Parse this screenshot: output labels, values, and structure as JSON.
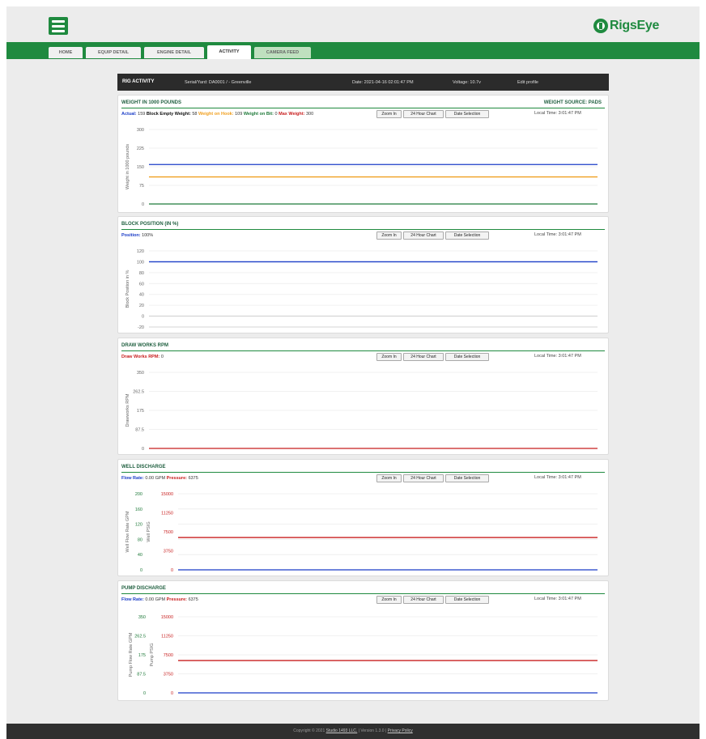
{
  "header": {
    "menu_icon": "hamburger-menu-icon",
    "logo_text": "RigsEye",
    "logo_icon": "rig-derrick-logo-icon",
    "brand_color": "#1f8a3f"
  },
  "nav": {
    "tabs": [
      {
        "label": "HOME"
      },
      {
        "label": "EQUIP DETAIL"
      },
      {
        "label": "ENGINE DETAIL"
      },
      {
        "label": "ACTIVITY"
      },
      {
        "label": "CAMERA FEED"
      }
    ],
    "active": "ACTIVITY"
  },
  "rigbar": {
    "title": "RIG ACTIVITY",
    "serial": "Serial/Yard: DA0001 / - Greenville",
    "date": "Date: 2021-04-16 02:01:47 PM",
    "voltage": "Voltage: 10.7v",
    "edit_profile": "Edit profile"
  },
  "buttons": {
    "zoom": "Zoom In",
    "h24": "24 Hour Chart",
    "date_sel": "Date Selection"
  },
  "panels": {
    "weight": {
      "title": "WEIGHT IN 1000 POUNDS",
      "source": "WEIGHT SOURCE: PADS",
      "info": [
        {
          "label": "Actual:",
          "value": "159",
          "color": "#1a3cc7"
        },
        {
          "label": "Block Empty Weight:",
          "value": "58",
          "color": "#111111"
        },
        {
          "label": "Weight on Hook:",
          "value": "109",
          "color": "#f0a020"
        },
        {
          "label": "Weight on Bit:",
          "value": "0",
          "color": "#1f7a3a"
        },
        {
          "label": "Max Weight:",
          "value": "300",
          "color": "#c81e1e"
        }
      ],
      "local_time": "Local Time: 3:01:47 PM"
    },
    "block": {
      "title": "BLOCK POSITION (IN %)",
      "info": [
        {
          "label": "Position:",
          "value": "100%",
          "color": "#1a3cc7"
        }
      ],
      "local_time": "Local Time: 3:01:47 PM"
    },
    "drawworks": {
      "title": "DRAW WORKS RPM",
      "info": [
        {
          "label": "Draw Works RPM:",
          "value": "0",
          "color": "#c81e1e"
        }
      ],
      "local_time": "Local Time: 3:01:47 PM"
    },
    "well": {
      "title": "WELL DISCHARGE",
      "info": [
        {
          "label": "Flow Rate:",
          "value": "0.00 GPM",
          "color": "#1a3cc7"
        },
        {
          "label": "Pressure:",
          "value": "6375",
          "color": "#c81e1e"
        }
      ],
      "local_time": "Local Time: 3:01:47 PM"
    },
    "pump": {
      "title": "PUMP DISCHARGE",
      "info": [
        {
          "label": "Flow Rate:",
          "value": "0.00 GPM",
          "color": "#1a3cc7"
        },
        {
          "label": "Pressure:",
          "value": "6375",
          "color": "#c81e1e"
        }
      ],
      "local_time": "Local Time: 3:01:47 PM"
    }
  },
  "chart_data": [
    {
      "type": "line",
      "ylabel": "Weight in 1000 pounds",
      "ylim": [
        0,
        300
      ],
      "yticks": [
        "0",
        "75",
        "150",
        "225",
        "300"
      ],
      "series": [
        {
          "values": [
            159,
            159
          ],
          "color": "#1a3cc7"
        },
        {
          "values": [
            109,
            109
          ],
          "color": "#f0a020"
        },
        {
          "values": [
            0,
            0
          ],
          "color": "#1f7a3a"
        }
      ],
      "grid": true
    },
    {
      "type": "line",
      "ylabel": "Block Position in %",
      "ylim": [
        -20,
        120
      ],
      "yticks": [
        "-20",
        "0",
        "20",
        "40",
        "60",
        "80",
        "100",
        "120"
      ],
      "series": [
        {
          "values": [
            100,
            100
          ],
          "color": "#1a3cc7"
        }
      ],
      "grid": true
    },
    {
      "type": "line",
      "ylabel": "Drawworks RPM",
      "ylim": [
        0,
        350
      ],
      "yticks": [
        "0",
        "87.5",
        "175",
        "262.5",
        "350"
      ],
      "series": [
        {
          "values": [
            0,
            0
          ],
          "color": "#c81e1e"
        }
      ],
      "grid": true
    },
    {
      "type": "line",
      "ylabel": "Well Flow Rate GPM",
      "ylabel2": "Well PSIG",
      "ylim": [
        0,
        200
      ],
      "ylim2": [
        0,
        15000
      ],
      "yticks": [
        "0",
        "40",
        "80",
        "120",
        "160",
        "200"
      ],
      "yticks2": [
        "0",
        "3750",
        "7500",
        "11250",
        "15000"
      ],
      "series": [
        {
          "values": [
            0,
            0
          ],
          "color": "#1a3cc7",
          "axis": "left"
        },
        {
          "values": [
            6375,
            6375
          ],
          "color": "#c81e1e",
          "axis": "right"
        }
      ],
      "grid": true
    },
    {
      "type": "line",
      "ylabel": "Pump Flow Rate GPM",
      "ylabel2": "Pump PSIG",
      "ylim": [
        0,
        350
      ],
      "ylim2": [
        0,
        15000
      ],
      "yticks": [
        "0",
        "87.5",
        "175",
        "262.5",
        "350"
      ],
      "yticks2": [
        "0",
        "3750",
        "7500",
        "11250",
        "15000"
      ],
      "series": [
        {
          "values": [
            0,
            0
          ],
          "color": "#1a3cc7",
          "axis": "left"
        },
        {
          "values": [
            6375,
            6375
          ],
          "color": "#c81e1e",
          "axis": "right"
        }
      ],
      "grid": true
    }
  ],
  "footer": {
    "copyright": "Copyright © 2021",
    "studio": "Studio 1493 LLC.",
    "version": "| Version 1.3.0 |",
    "privacy": "Privacy Policy"
  }
}
